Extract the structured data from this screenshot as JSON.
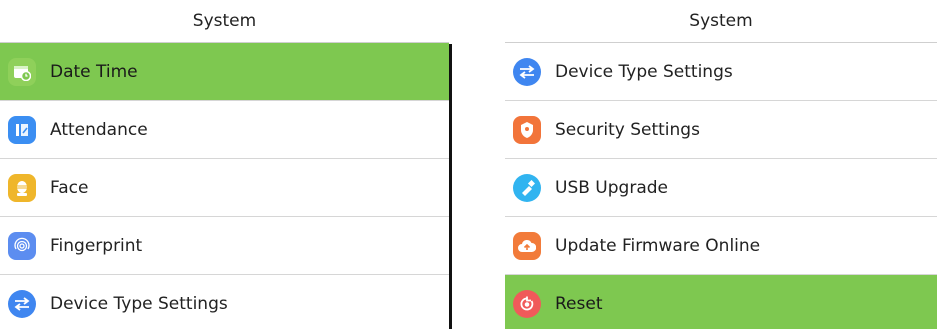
{
  "left": {
    "title": "System",
    "items": [
      {
        "label": "Date Time",
        "icon": "calendar-clock-icon",
        "color": "#7ec850",
        "selected": true
      },
      {
        "label": "Attendance",
        "icon": "attendance-icon",
        "color": "#3b8ef2",
        "selected": false
      },
      {
        "label": "Face",
        "icon": "face-icon",
        "color": "#efb62b",
        "selected": false
      },
      {
        "label": "Fingerprint",
        "icon": "fingerprint-icon",
        "color": "#5c8df0",
        "selected": false
      },
      {
        "label": "Device Type Settings",
        "icon": "swap-arrows-icon",
        "color": "#3f86f0",
        "selected": false
      }
    ]
  },
  "right": {
    "title": "System",
    "items": [
      {
        "label": "Device Type Settings",
        "icon": "swap-arrows-icon",
        "color": "#3f86f0",
        "selected": false
      },
      {
        "label": "Security Settings",
        "icon": "shield-icon",
        "color": "#f2743a",
        "selected": false
      },
      {
        "label": "USB Upgrade",
        "icon": "usb-icon",
        "color": "#31b4f0",
        "selected": false
      },
      {
        "label": "Update Firmware Online",
        "icon": "cloud-upload-icon",
        "color": "#f27b3a",
        "selected": false
      },
      {
        "label": "Reset",
        "icon": "reset-icon",
        "color": "#f05a5a",
        "selected": true
      }
    ]
  },
  "colors": {
    "selected_bg": "#7ec850",
    "divider": "#111111"
  }
}
